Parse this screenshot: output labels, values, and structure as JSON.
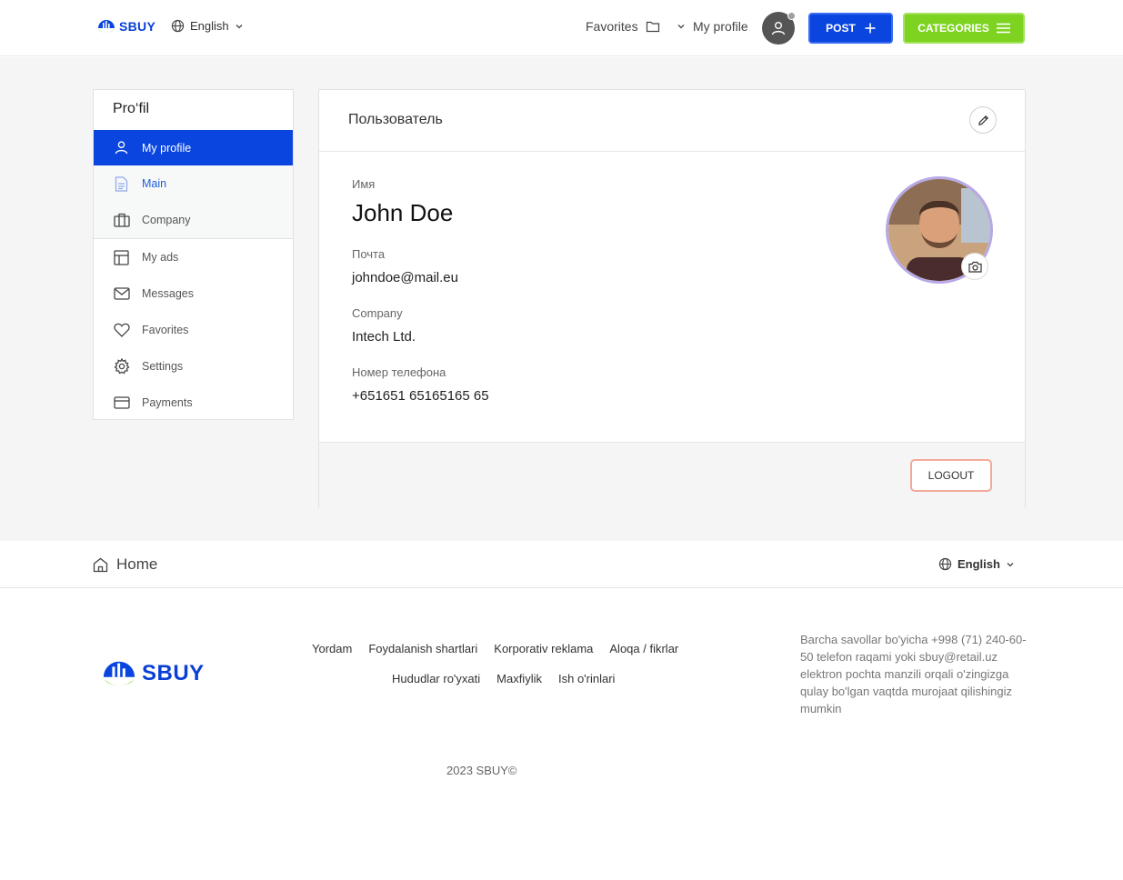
{
  "header": {
    "logo_text": "SBUY",
    "language": "English",
    "favorites_label": "Favorites",
    "my_profile_label": "My profile",
    "post_label": "POST",
    "categories_label": "CATEGORIES"
  },
  "sidebar": {
    "title": "Pro‘fil",
    "items": [
      {
        "label": "My profile",
        "icon": "user-icon"
      },
      {
        "label": "Main",
        "icon": "document-icon"
      },
      {
        "label": "Company",
        "icon": "briefcase-icon"
      },
      {
        "label": "My ads",
        "icon": "layout-icon"
      },
      {
        "label": "Messages",
        "icon": "mail-icon"
      },
      {
        "label": "Favorites",
        "icon": "heart-icon"
      },
      {
        "label": "Settings",
        "icon": "gear-icon"
      },
      {
        "label": "Payments",
        "icon": "credit-card-icon"
      }
    ]
  },
  "profile": {
    "card_title": "Пользователь",
    "name_label": "Имя",
    "name": "John Doe",
    "email_label": "Почта",
    "email": "johndoe@mail.eu",
    "company_label": "Company",
    "company": "Intech Ltd.",
    "phone_label": "Номер телефона",
    "phone": "+651651 65165165 65",
    "logout_label": "LOGOUT"
  },
  "bottom_bar": {
    "home_label": "Home",
    "language": "English"
  },
  "footer": {
    "logo_text": "SBUY",
    "links_row1": [
      "Yordam",
      "Foydalanish shartlari",
      "Korporativ reklama",
      "Aloqa / fikrlar"
    ],
    "links_row2": [
      "Hududlar ro'yxati",
      "Maxfiylik",
      "Ish o'rinlari"
    ],
    "description": "Barcha savollar bo'yicha +998 (71) 240-60-50 telefon raqami yoki sbuy@retail.uz elektron pochta manzili orqali o'zingizga qulay bo'lgan vaqtda murojaat qilishingiz mumkin",
    "copyright": "2023 SBUY©"
  },
  "colors": {
    "primary_blue": "#0a45e0",
    "accent_green": "#7ed321",
    "logout_border": "#f3a99a"
  }
}
